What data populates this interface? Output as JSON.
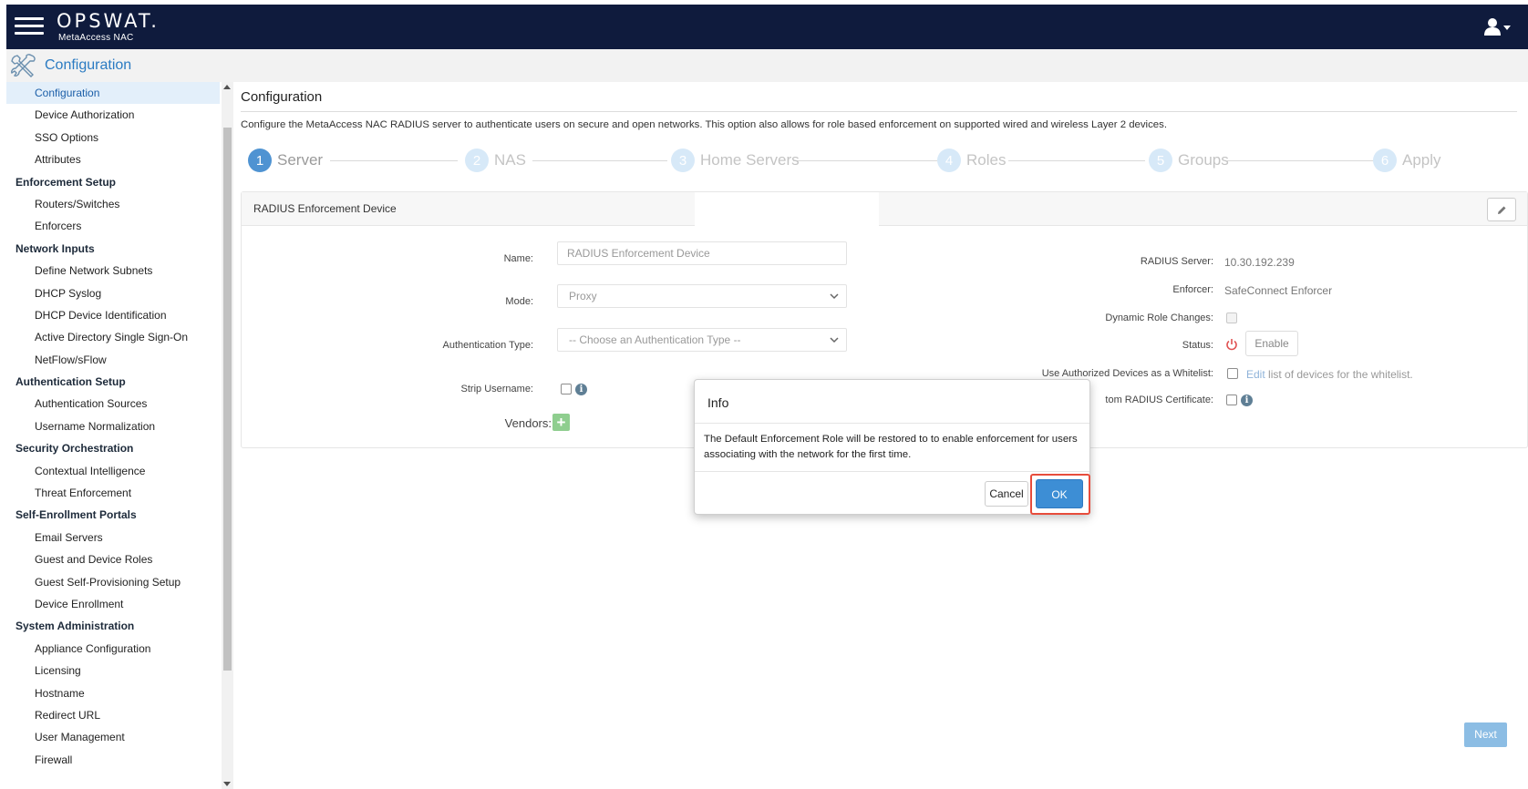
{
  "header": {
    "brand": "OPSWAT.",
    "product": "MetaAccess NAC",
    "menu_icon": "hamburger-menu-icon",
    "user_icon": "user-dropdown-icon"
  },
  "section": {
    "title": "Configuration",
    "icon": "tools-icon"
  },
  "sidebar": {
    "items": [
      {
        "label": "Configuration",
        "type": "sub",
        "active": true
      },
      {
        "label": "Device Authorization",
        "type": "sub"
      },
      {
        "label": "SSO Options",
        "type": "sub"
      },
      {
        "label": "Attributes",
        "type": "sub"
      },
      {
        "label": "Enforcement Setup",
        "type": "group"
      },
      {
        "label": "Routers/Switches",
        "type": "sub"
      },
      {
        "label": "Enforcers",
        "type": "sub"
      },
      {
        "label": "Network Inputs",
        "type": "group"
      },
      {
        "label": "Define Network Subnets",
        "type": "sub"
      },
      {
        "label": "DHCP Syslog",
        "type": "sub"
      },
      {
        "label": "DHCP Device Identification",
        "type": "sub"
      },
      {
        "label": "Active Directory Single Sign-On",
        "type": "sub"
      },
      {
        "label": "NetFlow/sFlow",
        "type": "sub"
      },
      {
        "label": "Authentication Setup",
        "type": "group"
      },
      {
        "label": "Authentication Sources",
        "type": "sub"
      },
      {
        "label": "Username Normalization",
        "type": "sub"
      },
      {
        "label": "Security Orchestration",
        "type": "group"
      },
      {
        "label": "Contextual Intelligence",
        "type": "sub"
      },
      {
        "label": "Threat Enforcement",
        "type": "sub"
      },
      {
        "label": "Self-Enrollment Portals",
        "type": "group"
      },
      {
        "label": "Email Servers",
        "type": "sub"
      },
      {
        "label": "Guest and Device Roles",
        "type": "sub"
      },
      {
        "label": "Guest Self-Provisioning Setup",
        "type": "sub"
      },
      {
        "label": "Device Enrollment",
        "type": "sub"
      },
      {
        "label": "System Administration",
        "type": "group"
      },
      {
        "label": "Appliance Configuration",
        "type": "sub"
      },
      {
        "label": "Licensing",
        "type": "sub"
      },
      {
        "label": "Hostname",
        "type": "sub"
      },
      {
        "label": "Redirect URL",
        "type": "sub"
      },
      {
        "label": "User Management",
        "type": "sub"
      },
      {
        "label": "Firewall",
        "type": "sub"
      }
    ]
  },
  "main": {
    "title": "Configuration",
    "description": "Configure the MetaAccess NAC RADIUS server to authenticate users on secure and open networks. This option also allows for role based enforcement on supported wired and wireless Layer 2 devices.",
    "steps": [
      {
        "num": "1",
        "label": "Server",
        "current": true
      },
      {
        "num": "2",
        "label": "NAS"
      },
      {
        "num": "3",
        "label": "Home Servers"
      },
      {
        "num": "4",
        "label": "Roles"
      },
      {
        "num": "5",
        "label": "Groups"
      },
      {
        "num": "6",
        "label": "Apply"
      }
    ],
    "panel": {
      "title": "RADIUS Enforcement Device",
      "edit_icon": "pencil-icon",
      "left": {
        "name_label": "Name:",
        "name_value": "RADIUS Enforcement Device",
        "mode_label": "Mode:",
        "mode_value": "Proxy",
        "auth_type_label": "Authentication Type:",
        "auth_type_value": "-- Choose an Authentication Type --",
        "strip_username_label": "Strip Username:",
        "vendors_label": "Vendors:",
        "vendors_add": "+"
      },
      "right": {
        "radius_server_label": "RADIUS Server:",
        "radius_server_value": "10.30.192.239",
        "enforcer_label": "Enforcer:",
        "enforcer_value": "SafeConnect Enforcer",
        "dynamic_role_label": "Dynamic Role Changes:",
        "status_label": "Status:",
        "enable_button": "Enable",
        "whitelist_label": "Use Authorized Devices as a Whitelist:",
        "whitelist_edit": "Edit",
        "whitelist_suffix": " list of devices for the whitelist.",
        "cert_label": "tom RADIUS Certificate:"
      }
    },
    "next_button": "Next"
  },
  "modal": {
    "title": "Info",
    "message": "The Default Enforcement Role will be restored to to enable enforcement for users associating with the network for the first time.",
    "cancel_label": "Cancel",
    "ok_label": "OK",
    "highlight_color": "#e74c3c"
  },
  "colors": {
    "topbar": "#0f1b3d",
    "accent": "#2b7bc2",
    "primary_button": "#3d8ed5",
    "active_nav_bg": "#e3effa"
  }
}
